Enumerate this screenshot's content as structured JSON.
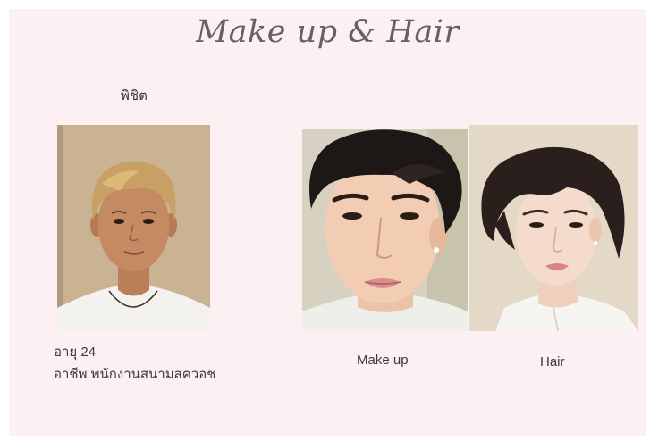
{
  "slide": {
    "title": "Make up & Hair",
    "background_color": "#fdf0f2"
  },
  "subject": {
    "name": "พิชิต",
    "age": "อายุ 24",
    "occupation": "อาชีพ พนักงานสนามสควอช"
  },
  "photos": {
    "before_icon": "portrait-blond-man-photo",
    "makeup_icon": "portrait-makeup-reference-photo",
    "hair_icon": "portrait-hair-reference-photo"
  },
  "captions": {
    "makeup": "Make up",
    "hair": "Hair"
  }
}
